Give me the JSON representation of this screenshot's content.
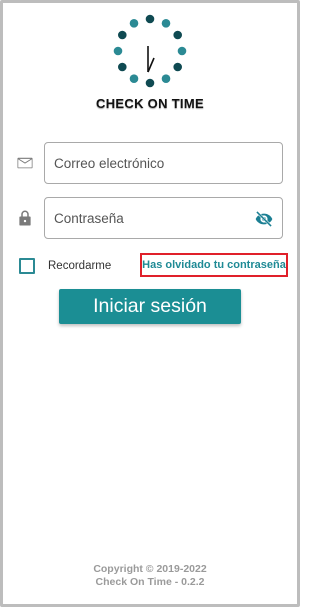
{
  "brand": {
    "name": "CHECK ON TIME",
    "logo_icon": "clock-dots-logo",
    "dot_colors": [
      "#0f4a52",
      "#2b8a94"
    ]
  },
  "login": {
    "email_placeholder": "Correo electrónico",
    "email_icon": "envelope-icon",
    "password_placeholder": "Contraseña",
    "password_icon": "lock-icon",
    "password_toggle_icon": "eye-off-icon",
    "remember_label": "Recordarme",
    "remember_checked": false,
    "forgot_password": "Has olvidado tu contraseña",
    "submit_label": "Iniciar sesión"
  },
  "footer": {
    "copyright": "Copyright © 2019-2022",
    "version": "Check On Time - 0.2.2"
  },
  "colors": {
    "accent": "#1b8e94",
    "link": "#1f8a95",
    "highlight_border": "#e0202a",
    "icon_gray": "#7a7a7a"
  }
}
